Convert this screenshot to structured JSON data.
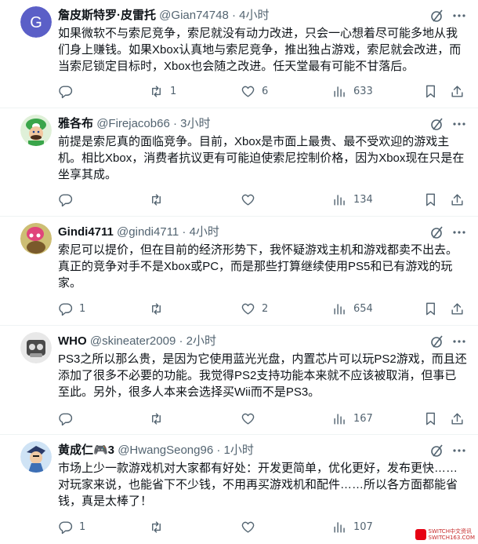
{
  "tweets": [
    {
      "name": "詹皮斯特罗·皮雷托",
      "handle": "@Gian74748",
      "sep": "·",
      "time": "4小时",
      "text": "如果微软不与索尼竞争，索尼就没有动力改进，只会一心想着尽可能多地从我们身上赚钱。如果Xbox认真地与索尼竞争，推出独占游戏，索尼就会改进，而当索尼锁定目标时，Xbox也会随之改进。任天堂最有可能不甘落后。",
      "reply_count": "",
      "retweet_count": "1",
      "like_count": "6",
      "view_count": "633",
      "avatar_letter": "G",
      "avatar_color": "#5b5fc7"
    },
    {
      "name": "雅各布",
      "handle": "@Firejacob66",
      "sep": "·",
      "time": "3小时",
      "text": "前提是索尼真的面临竞争。目前，Xbox是市面上最贵、最不受欢迎的游戏主机。相比Xbox，消费者抗议更有可能迫使索尼控制价格，因为Xbox现在只是在坐享其成。",
      "reply_count": "",
      "retweet_count": "",
      "like_count": "",
      "view_count": "134"
    },
    {
      "name": "Gindi4711",
      "handle": "@gindi4711",
      "sep": "·",
      "time": "4小时",
      "text": "索尼可以提价，但在目前的经济形势下，我怀疑游戏主机和游戏都卖不出去。真正的竞争对手不是Xbox或PC，而是那些打算继续使用PS5和已有游戏的玩家。",
      "reply_count": "1",
      "retweet_count": "",
      "like_count": "2",
      "view_count": "654"
    },
    {
      "name": "WHO",
      "handle": "@skineater2009",
      "sep": "·",
      "time": "2小时",
      "text": "PS3之所以那么贵，是因为它使用蓝光光盘，内置芯片可以玩PS2游戏，而且还添加了很多不必要的功能。我觉得PS2支持功能本来就不应该被取消，但事已至此。另外，很多人本来会选择买Wii而不是PS3。",
      "reply_count": "",
      "retweet_count": "",
      "like_count": "",
      "view_count": "167"
    },
    {
      "name": "黄成仁🎮3",
      "handle": "@HwangSeong96",
      "sep": "·",
      "time": "1小时",
      "text": "市场上少一款游戏机对大家都有好处：开发更简单，优化更好，发布更快……对玩家来说，也能省下不少钱，不用再买游戏机和配件……所以各方面都能省钱，真是太棒了！",
      "reply_count": "1",
      "retweet_count": "",
      "like_count": "",
      "view_count": "107"
    }
  ],
  "watermark": {
    "line1": "SWITCH中文资讯",
    "line2": "SWITCH163.COM"
  },
  "colors": {
    "text": "#0f1419",
    "muted": "#536471",
    "divider": "#eff3f4"
  }
}
